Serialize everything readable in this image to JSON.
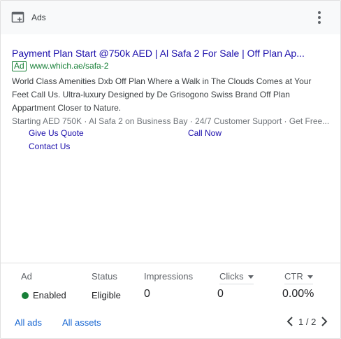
{
  "header": {
    "title": "Ads"
  },
  "ad": {
    "title": "Payment Plan Start @750k AED | Al Safa 2 For Sale | Off Plan Ap...",
    "badge": "Ad",
    "url": "www.which.ae/safa-2",
    "description": "World Class Amenities Dxb Off Plan Where a Walk in The Clouds Comes at Your Feet Call Us. Ultra-luxury Designed by De Grisogono Swiss Brand Off Plan Appartment Closer to Nature.",
    "extensions": "Starting AED 750K · Al Safa 2 on Business Bay · 24/7 Customer Support · Get Free...",
    "sitelinks": [
      "Give Us Quote",
      "Call Now",
      "Contact Us"
    ]
  },
  "metrics": {
    "headers": {
      "ad": "Ad",
      "status": "Status",
      "impressions": "Impressions",
      "clicks": "Clicks",
      "ctr": "CTR"
    },
    "values": {
      "ad": "Enabled",
      "status": "Eligible",
      "impressions": "0",
      "clicks": "0",
      "ctr": "0.00%"
    }
  },
  "footer": {
    "all_ads": "All ads",
    "all_assets": "All assets",
    "page": "1 / 2"
  },
  "colors": {
    "link": "#1a0dab",
    "green": "#188038",
    "blue": "#1967d2"
  },
  "icons": {
    "header": "add-to-queue-icon",
    "menu": "more-vert-icon",
    "prev": "chevron-left-icon",
    "next": "chevron-right-icon"
  }
}
